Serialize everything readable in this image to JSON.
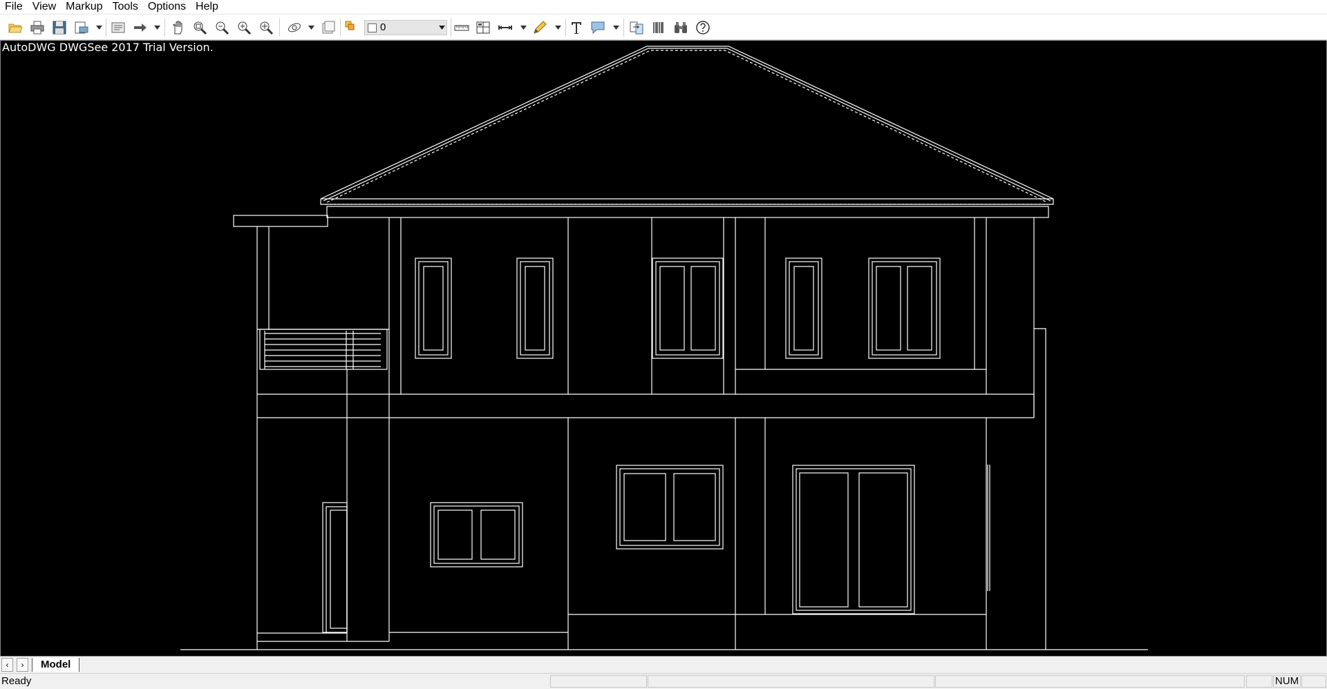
{
  "menu": [
    "File",
    "View",
    "Markup",
    "Tools",
    "Options",
    "Help"
  ],
  "toolbar": {
    "icons": [
      "open-folder-icon",
      "print-icon",
      "save-icon",
      "print-preview-icon",
      "layout-icon",
      "arrow-right-icon",
      "pan-hand-icon",
      "zoom-window-icon",
      "zoom-out-icon",
      "zoom-in-icon",
      "zoom-extents-icon",
      "orbit-icon",
      "layer-properties-icon",
      "layers-icon",
      "distance-icon",
      "area-icon",
      "dimension-icon",
      "pen-markup-icon",
      "text-icon",
      "callout-icon",
      "compare-icon",
      "barcode-icon",
      "binoculars-icon",
      "help-icon"
    ],
    "layer_value": "0"
  },
  "canvas": {
    "trial_text": "AutoDWG DWGSee 2017 Trial Version."
  },
  "tabs": {
    "model": "Model"
  },
  "status": {
    "ready": "Ready",
    "num": "NUM"
  }
}
